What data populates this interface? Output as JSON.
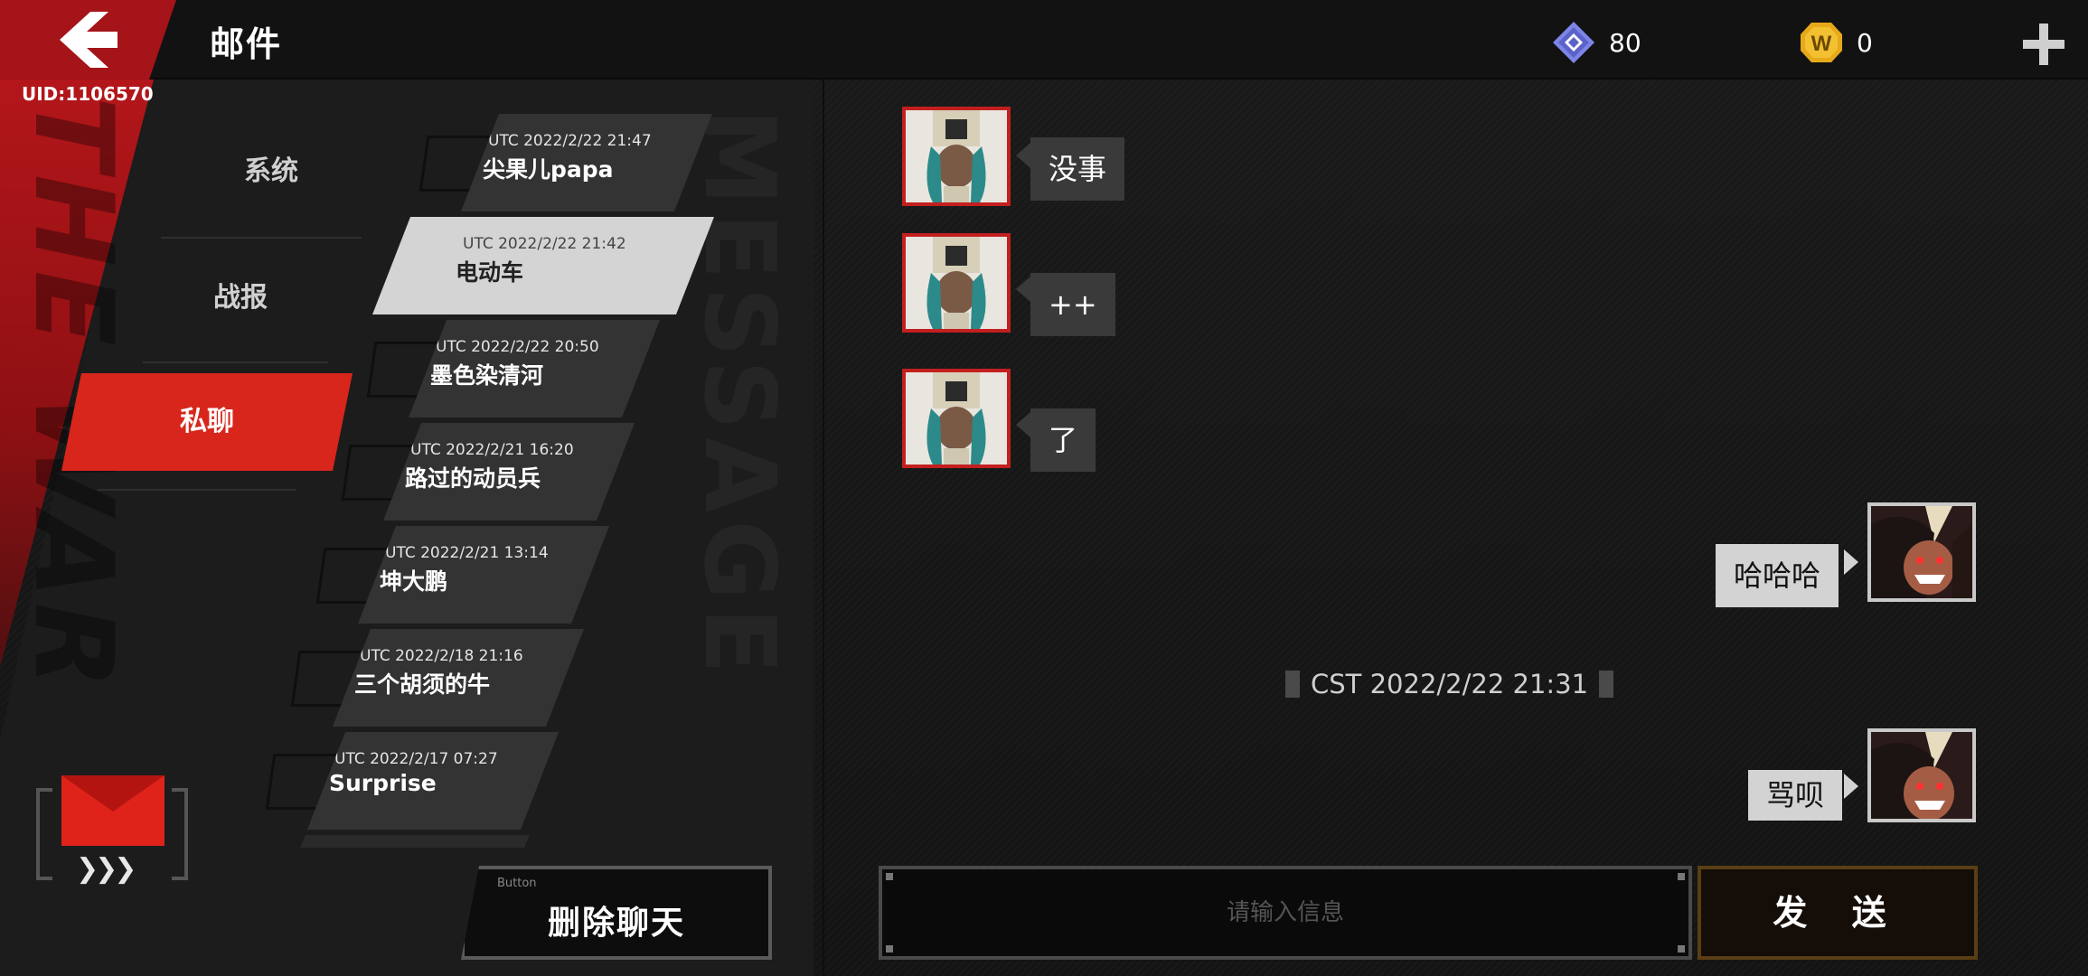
{
  "header": {
    "title": "邮件",
    "uid": "UID:1106570",
    "gems": "80",
    "coins": "0"
  },
  "categories": [
    "系统",
    "战报",
    "私聊"
  ],
  "active_category": "私聊",
  "chats": [
    {
      "time": "UTC 2022/2/22 21:47",
      "name": "尖果儿papa"
    },
    {
      "time": "UTC 2022/2/22 21:42",
      "name": "电动车"
    },
    {
      "time": "UTC 2022/2/22 20:50",
      "name": "墨色染清河"
    },
    {
      "time": "UTC 2022/2/21 16:20",
      "name": "路过的动员兵"
    },
    {
      "time": "UTC 2022/2/21 13:14",
      "name": "坤大鹏"
    },
    {
      "time": "UTC 2022/2/18 21:16",
      "name": "三个胡须的牛"
    },
    {
      "time": "UTC 2022/2/17 07:27",
      "name": "Surprise"
    }
  ],
  "delete_button": {
    "small": "Button",
    "label": "删除聊天"
  },
  "messages": [
    {
      "side": "left",
      "text": "没事"
    },
    {
      "side": "left",
      "text": "++"
    },
    {
      "side": "left",
      "text": "了"
    },
    {
      "side": "right",
      "text": "哈哈哈"
    },
    {
      "side": "right",
      "text": "骂呗"
    }
  ],
  "timestamp": "CST 2022/2/22 21:31",
  "input": {
    "placeholder": "请输入信息",
    "value": ""
  },
  "send_label": "发 送",
  "decor": {
    "side_text": "THE WAR",
    "bg_text": "MESSAGE"
  },
  "colors": {
    "accent": "#d8261c",
    "active_chat": "#d4d4d4",
    "chat_bg": "#333333"
  }
}
